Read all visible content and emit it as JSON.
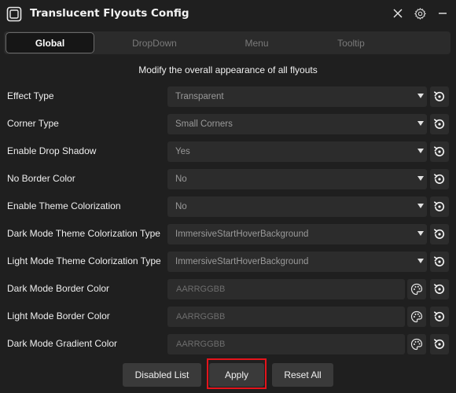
{
  "window": {
    "title": "Translucent Flyouts Config"
  },
  "tabs": [
    {
      "label": "Global"
    },
    {
      "label": "DropDown"
    },
    {
      "label": "Menu"
    },
    {
      "label": "Tooltip"
    }
  ],
  "subtitle": "Modify the overall appearance of all flyouts",
  "rows": [
    {
      "label": "Effect Type",
      "value": "Transparent"
    },
    {
      "label": "Corner Type",
      "value": "Small Corners"
    },
    {
      "label": "Enable Drop Shadow",
      "value": "Yes"
    },
    {
      "label": "No Border Color",
      "value": "No"
    },
    {
      "label": "Enable Theme Colorization",
      "value": "No"
    },
    {
      "label": "Dark Mode Theme Colorization Type",
      "value": "ImmersiveStartHoverBackground"
    },
    {
      "label": "Light Mode Theme Colorization Type",
      "value": "ImmersiveStartHoverBackground"
    },
    {
      "label": "Dark Mode Border Color",
      "placeholder": "AARRGGBB"
    },
    {
      "label": "Light Mode Border Color",
      "placeholder": "AARRGGBB"
    },
    {
      "label": "Dark Mode Gradient Color",
      "placeholder": "AARRGGBB"
    }
  ],
  "buttons": {
    "disabled_list": "Disabled List",
    "apply": "Apply",
    "reset_all": "Reset All"
  },
  "icons": {
    "app": "app-window-icon",
    "settings": "gear-icon",
    "close": "close-icon",
    "reset": "reset-icon",
    "color_picker": "palette-icon",
    "dropdown": "chevron-down-icon"
  },
  "colors": {
    "background": "#1f1f1f",
    "control": "#2c2c2c",
    "highlight": "#e5141b"
  }
}
